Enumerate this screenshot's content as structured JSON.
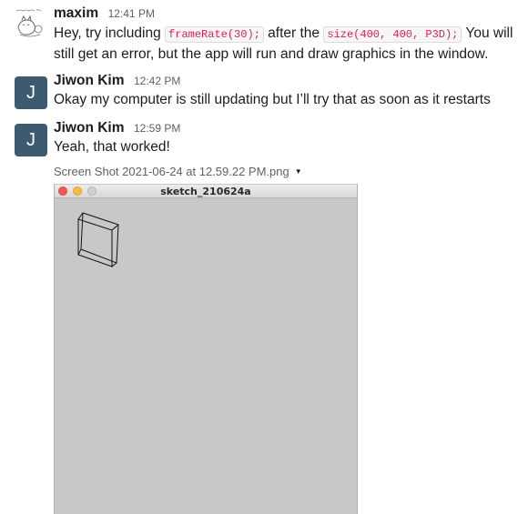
{
  "messages": [
    {
      "sender": "maxim",
      "time": "12:41 PM",
      "avatar": "sleeping-cat-sketch-icon",
      "text_1": "Hey, try including ",
      "code_1": "frameRate(30);",
      "text_2": " after the ",
      "code_2": "size(400, 400, P3D);",
      "text_3": " You will still get an error, but the app will run and draw graphics in the window."
    },
    {
      "sender": "Jiwon Kim",
      "time": "12:42 PM",
      "avatar_initial": "J",
      "text": "Okay my computer is still updating but I’ll try that as soon as it restarts"
    },
    {
      "sender": "Jiwon Kim",
      "time": "12:59 PM",
      "avatar_initial": "J",
      "text": "Yeah, that worked!"
    }
  ],
  "attachment": {
    "filename": "Screen Shot 2021-06-24 at 12.59.22 PM.png",
    "caret_icon": "caret-down-icon",
    "window_title": "sketch_210624a",
    "window_bg": "#c8c8c8"
  },
  "colors": {
    "avatar_bg": "#3c5a70",
    "code_text": "#e01e5a",
    "timestamp": "#616061"
  }
}
